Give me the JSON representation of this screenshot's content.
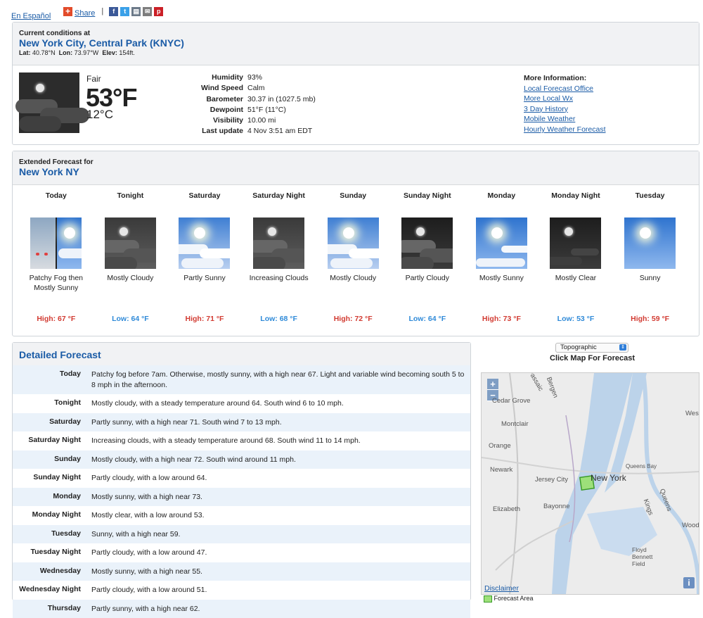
{
  "top": {
    "language_link": "En Español",
    "share_label": "Share"
  },
  "current": {
    "heading": "Current conditions at",
    "station": "New York City, Central Park (KNYC)",
    "lat_label": "Lat:",
    "lat": "40.78°N",
    "lon_label": "Lon:",
    "lon": "73.97°W",
    "elev_label": "Elev:",
    "elev": "154ft.",
    "condition": "Fair",
    "temp_f": "53°F",
    "temp_c": "12°C",
    "details": [
      {
        "label": "Humidity",
        "value": "93%"
      },
      {
        "label": "Wind Speed",
        "value": "Calm"
      },
      {
        "label": "Barometer",
        "value": "30.37 in (1027.5 mb)"
      },
      {
        "label": "Dewpoint",
        "value": "51°F (11°C)"
      },
      {
        "label": "Visibility",
        "value": "10.00 mi"
      },
      {
        "label": "Last update",
        "value": "4 Nov 3:51 am EDT"
      }
    ],
    "more_heading": "More Information:",
    "more_links": [
      "Local Forecast Office",
      "More Local Wx",
      "3 Day History",
      "Mobile Weather",
      "Hourly Weather Forecast"
    ]
  },
  "extended": {
    "heading": "Extended Forecast for",
    "location": "New York NY",
    "days": [
      {
        "name": "Today",
        "short": "Patchy Fog then Mostly Sunny",
        "temp": "High: 67 °F",
        "kind": "high",
        "icon": "fog-sunny-icon"
      },
      {
        "name": "Tonight",
        "short": "Mostly Cloudy",
        "temp": "Low: 64 °F",
        "kind": "low",
        "icon": "night-cloudy-icon"
      },
      {
        "name": "Saturday",
        "short": "Partly Sunny",
        "temp": "High: 71 °F",
        "kind": "high",
        "icon": "partly-sunny-icon"
      },
      {
        "name": "Saturday Night",
        "short": "Increasing Clouds",
        "temp": "Low: 68 °F",
        "kind": "low",
        "icon": "night-cloudy-icon"
      },
      {
        "name": "Sunday",
        "short": "Mostly Cloudy",
        "temp": "High: 72 °F",
        "kind": "high",
        "icon": "partly-sunny-icon"
      },
      {
        "name": "Sunday Night",
        "short": "Partly Cloudy",
        "temp": "Low: 64 °F",
        "kind": "low",
        "icon": "night-partly-cloudy-icon"
      },
      {
        "name": "Monday",
        "short": "Mostly Sunny",
        "temp": "High: 73 °F",
        "kind": "high",
        "icon": "mostly-sunny-icon"
      },
      {
        "name": "Monday Night",
        "short": "Mostly Clear",
        "temp": "Low: 53 °F",
        "kind": "low",
        "icon": "night-clear-icon"
      },
      {
        "name": "Tuesday",
        "short": "Sunny",
        "temp": "High: 59 °F",
        "kind": "high",
        "icon": "sunny-icon"
      }
    ]
  },
  "detailed": {
    "heading": "Detailed Forecast",
    "rows": [
      {
        "label": "Today",
        "text": "Patchy fog before 7am. Otherwise, mostly sunny, with a high near 67. Light and variable wind becoming south 5 to 8 mph in the afternoon."
      },
      {
        "label": "Tonight",
        "text": "Mostly cloudy, with a steady temperature around 64. South wind 6 to 10 mph."
      },
      {
        "label": "Saturday",
        "text": "Partly sunny, with a high near 71. South wind 7 to 13 mph."
      },
      {
        "label": "Saturday Night",
        "text": "Increasing clouds, with a steady temperature around 68. South wind 11 to 14 mph."
      },
      {
        "label": "Sunday",
        "text": "Mostly cloudy, with a high near 72. South wind around 11 mph."
      },
      {
        "label": "Sunday Night",
        "text": "Partly cloudy, with a low around 64."
      },
      {
        "label": "Monday",
        "text": "Mostly sunny, with a high near 73."
      },
      {
        "label": "Monday Night",
        "text": "Mostly clear, with a low around 53."
      },
      {
        "label": "Tuesday",
        "text": "Sunny, with a high near 59."
      },
      {
        "label": "Tuesday Night",
        "text": "Partly cloudy, with a low around 47."
      },
      {
        "label": "Wednesday",
        "text": "Mostly sunny, with a high near 55."
      },
      {
        "label": "Wednesday Night",
        "text": "Partly cloudy, with a low around 51."
      },
      {
        "label": "Thursday",
        "text": "Partly sunny, with a high near 62."
      }
    ]
  },
  "map": {
    "select_value": "Topographic",
    "hint": "Click Map For Forecast",
    "disclaimer": "Disclaimer",
    "info": "i",
    "legend": "Forecast Area",
    "labels": [
      "Passaic",
      "Bergen",
      "Cedar Grove",
      "Montclair",
      "Orange",
      "Newark",
      "Jersey City",
      "New York",
      "Elizabeth",
      "Bayonne",
      "Queens Bay",
      "Queens",
      "Kings",
      "Floyd Bennett Field",
      "Wood",
      "Wes"
    ]
  }
}
